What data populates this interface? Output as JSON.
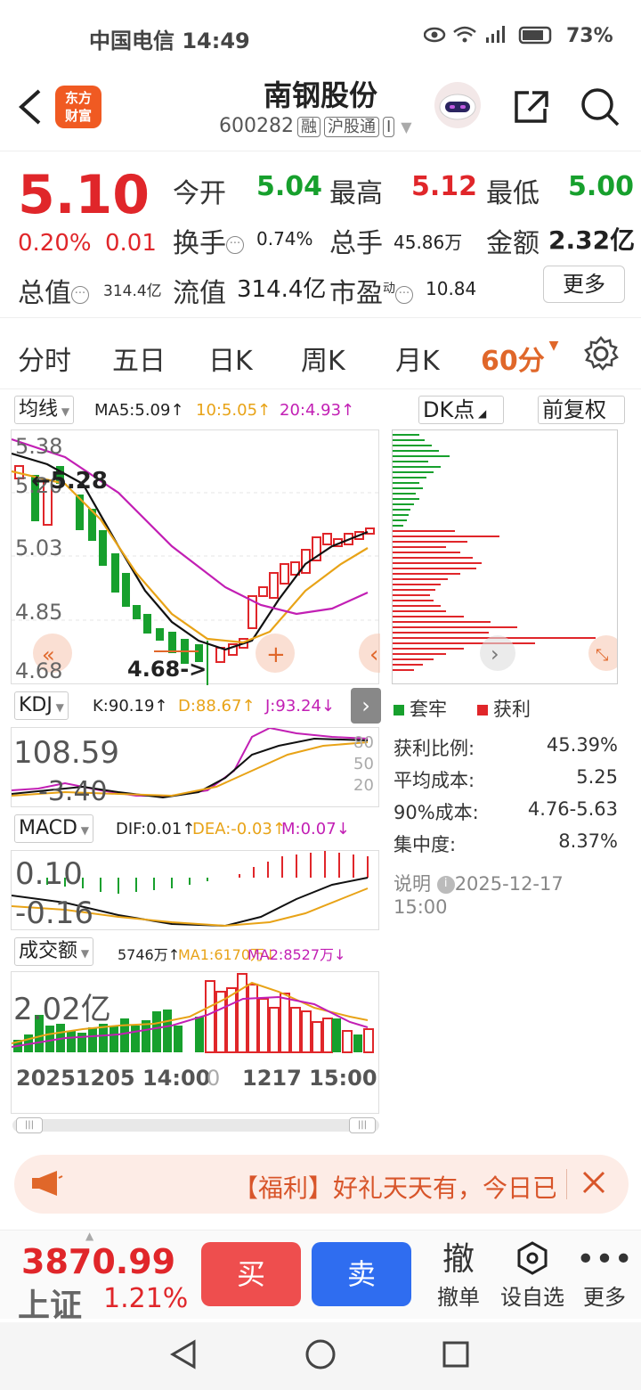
{
  "status": {
    "carrier_time": "中国电信 14:49",
    "battery": "73%"
  },
  "header": {
    "logo_line1": "东方",
    "logo_line2": "财富",
    "stock_name": "南钢股份",
    "stock_code": "600282",
    "tag1": "融",
    "tag2": "沪股通",
    "tag3": "I"
  },
  "quote": {
    "price": "5.10",
    "change_pct": "0.20%",
    "change_abs": "0.01",
    "open_label": "今开",
    "open": "5.04",
    "high_label": "最高",
    "high": "5.12",
    "low_label": "最低",
    "low": "5.00",
    "turnover_label": "换手",
    "turnover": "0.74%",
    "volume_label": "总手",
    "volume": "45.86万",
    "amount_label": "金额",
    "amount": "2.32亿",
    "total_val_label": "总值",
    "total_val": "314.4亿",
    "float_val_label": "流值",
    "float_val": "314.4亿",
    "pe_label": "市盈",
    "pe_sup": "动",
    "pe": "10.84",
    "more": "更多"
  },
  "period_tabs": [
    "分时",
    "五日",
    "日K",
    "周K",
    "月K",
    "60分"
  ],
  "kline": {
    "select": "均线",
    "ma5": "MA5:5.09",
    "ma10": "10:5.05",
    "ma20": "20:4.93",
    "dk": "DK点",
    "fq": "前复权",
    "y_labels": [
      "5.38",
      "5.20",
      "5.03",
      "4.85",
      "4.68"
    ],
    "max_marker": "←5.28",
    "min_marker": "4.68->"
  },
  "kdj": {
    "select": "KDJ",
    "k": "K:90.19",
    "d": "D:88.67",
    "j": "J:93.24",
    "top": "108.59",
    "bottom": "-3.40",
    "levels": [
      "80",
      "50",
      "20"
    ]
  },
  "macd": {
    "select": "MACD",
    "dif": "DIF:0.01",
    "dea": "DEA:-0.03",
    "m": "M:0.07",
    "top": "0.10",
    "bottom": "-0.16"
  },
  "volume": {
    "select": "成交额",
    "val": "5746万",
    "ma1": "MA1:6170万",
    "ma2": "MA2:8527万",
    "top": "2.02亿",
    "date_start": "20251205 14:00",
    "date_mid": "0",
    "date_end": "1217 15:00"
  },
  "chips": {
    "legend_trapped": "套牢",
    "legend_profit": "获利",
    "rows": [
      {
        "label": "获利比例:",
        "value": "45.39%"
      },
      {
        "label": "平均成本:",
        "value": "5.25"
      },
      {
        "label": "90%成本:",
        "value": "4.76-5.63"
      },
      {
        "label": "集中度:",
        "value": "8.37%"
      }
    ],
    "note_label": "说明",
    "note_time": "2025-12-17 15:00"
  },
  "banner": {
    "text": "【福利】好礼天天有，今日已"
  },
  "trade": {
    "index_value": "3870.99",
    "index_name": "上证",
    "index_pct": "1.21%",
    "buy": "买",
    "sell": "卖",
    "cancel_icon": "撤",
    "cancel": "撤单",
    "watch": "设自选",
    "more": "更多"
  },
  "colors": {
    "up": "#e0262a",
    "down": "#17a02d",
    "accent": "#e0672a",
    "buy": "#ee4e4e",
    "sell": "#2f6df0"
  }
}
